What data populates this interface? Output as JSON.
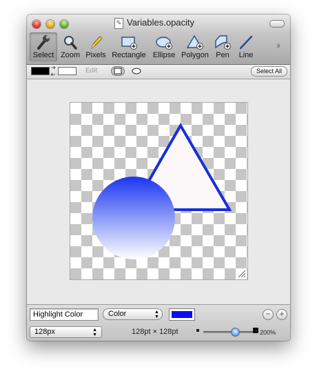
{
  "window": {
    "title": "Variables.opacity"
  },
  "toolbar": {
    "selected_tool": "Select",
    "tools": [
      {
        "label": "Select",
        "icon": "wrench-icon"
      },
      {
        "label": "Zoom",
        "icon": "magnifier-icon"
      },
      {
        "label": "Pixels",
        "icon": "pencil-icon"
      },
      {
        "label": "Rectangle",
        "icon": "rectangle-plus-icon"
      },
      {
        "label": "Ellipse",
        "icon": "ellipse-plus-icon"
      },
      {
        "label": "Polygon",
        "icon": "polygon-plus-icon"
      },
      {
        "label": "Pen",
        "icon": "pen-plus-icon"
      },
      {
        "label": "Line",
        "icon": "line-icon"
      }
    ],
    "overflow_icon": "chevron-double-right-icon"
  },
  "options_bar": {
    "stroke_color": "#000000",
    "fill_color": "#ffffff",
    "edit_label": "Edit",
    "select_all_label": "Select All"
  },
  "canvas": {
    "shapes": [
      {
        "type": "triangle",
        "fill": "#fcf8fa",
        "stroke": "#1a2ed8"
      },
      {
        "type": "circle",
        "gradient_top": "#1a36f0",
        "gradient_bottom": "#ffffff"
      }
    ]
  },
  "property_bar": {
    "property_name": "Highlight Color",
    "property_type": "Color",
    "color_value": "#0a0ef5",
    "remove_icon": "minus-circle-icon",
    "add_icon": "plus-circle-icon"
  },
  "status_bar": {
    "size": "128px",
    "dimensions": "128pt × 128pt",
    "zoom": "200%",
    "zoom_level": 0.62
  },
  "colors": {
    "selection_blue": "#1a2ed8"
  }
}
